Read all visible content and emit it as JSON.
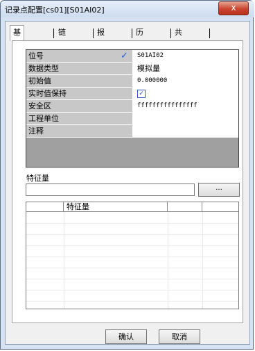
{
  "window": {
    "title": "记录点配置[cs01][S01AI02]",
    "close_label": "x"
  },
  "tabs": [
    {
      "label": "基本信息",
      "active": true
    },
    {
      "label": "链接信息"
    },
    {
      "label": "报警信息"
    },
    {
      "label": "历史信息"
    },
    {
      "label": "共享信息"
    }
  ],
  "props": {
    "rows": [
      {
        "key": "位号",
        "value": "S01AI02",
        "checked": true
      },
      {
        "key": "数据类型",
        "value": "模拟量"
      },
      {
        "key": "初始值",
        "value": "0.000000"
      },
      {
        "key": "实时值保持",
        "checkbox": true,
        "checkbox_mark": "✓"
      },
      {
        "key": "安全区",
        "value": "ffffffffffffffff"
      },
      {
        "key": "工程单位",
        "value": ""
      },
      {
        "key": "注释",
        "value": ""
      }
    ]
  },
  "feature": {
    "label": "特征量",
    "input_value": "",
    "browse_label": "...",
    "columns": [
      "",
      "特征量",
      "",
      ""
    ]
  },
  "buttons": {
    "ok": "确认",
    "cancel": "取消"
  }
}
